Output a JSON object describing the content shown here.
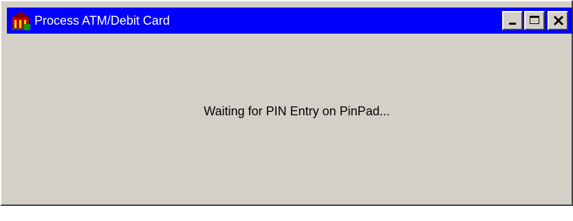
{
  "window": {
    "title": "Process ATM/Debit Card",
    "icon": "bank-building-icon",
    "controls": [
      "minimize-icon",
      "maximize-icon",
      "close-icon"
    ]
  },
  "content": {
    "message": "Waiting for PIN Entry on PinPad..."
  },
  "colors": {
    "titlebar": "#0000ff",
    "title_text": "#ffffff",
    "window_bg": "#d4d0c8"
  }
}
